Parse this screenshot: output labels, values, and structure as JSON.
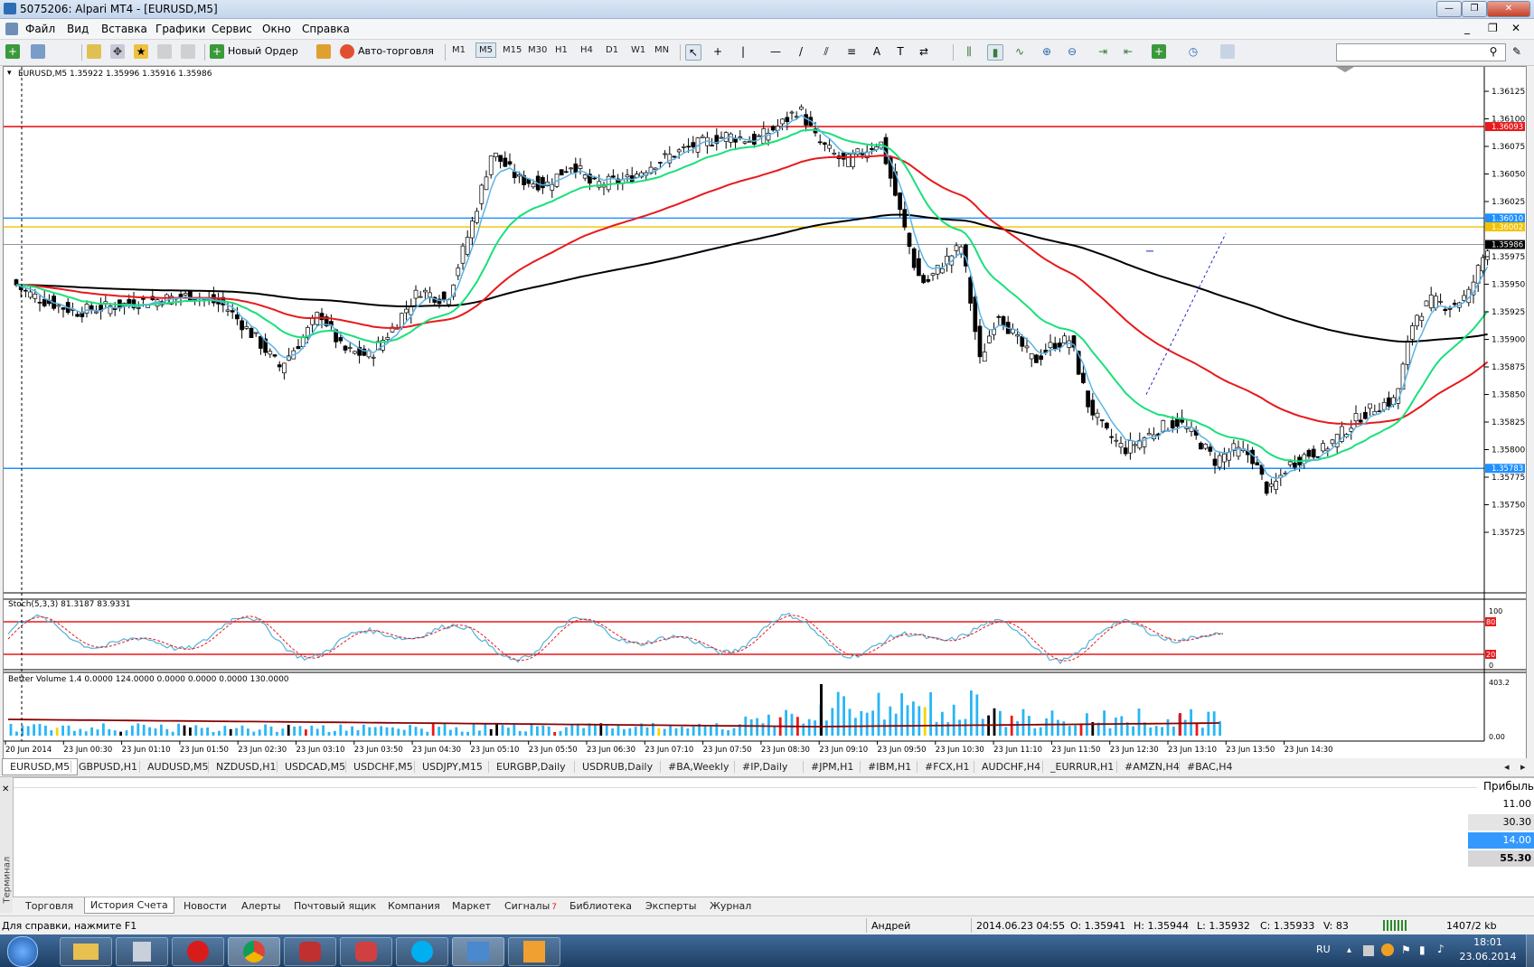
{
  "window": {
    "title": "5075206: Alpari MT4 - [EURUSD,M5]"
  },
  "menu": [
    "Файл",
    "Вид",
    "Вставка",
    "Графики",
    "Сервис",
    "Окно",
    "Справка"
  ],
  "toolbar": {
    "new_order": "Новый Ордер",
    "autotrade": "Авто-торговля",
    "timeframes": [
      "M1",
      "M5",
      "M15",
      "M30",
      "H1",
      "H4",
      "D1",
      "W1",
      "MN"
    ],
    "text_tool": "A",
    "active_timeframe": "M5"
  },
  "chart": {
    "header": "EURUSD,M5  1.35922 1.35996 1.35916 1.35986",
    "price_labels": [
      "1.36125",
      "1.36100",
      "1.36075",
      "1.36050",
      "1.36025",
      "1.35975",
      "1.35950",
      "1.35925",
      "1.35900",
      "1.35875",
      "1.35850",
      "1.35825",
      "1.35800",
      "1.35775",
      "1.35750",
      "1.35725"
    ],
    "marker_labels": {
      "red": "1.36093",
      "blue_top": "1.36010",
      "yellow": "1.36002",
      "current": "1.35986",
      "blue_bottom": "1.35783"
    },
    "stoch_header": "Stoch(5,3,3) 81.3187 83.9331",
    "stoch_levels": [
      "100",
      "80",
      "20",
      "0"
    ],
    "volume_header": "Better Volume 1.4 0.0000 124.0000 0.0000 0.0000 0.0000 130.0000",
    "volume_levels": {
      "top": "403.2",
      "bottom": "0.00"
    },
    "time_labels": [
      "20 Jun 2014",
      "23 Jun 00:30",
      "23 Jun 01:10",
      "23 Jun 01:50",
      "23 Jun 02:30",
      "23 Jun 03:10",
      "23 Jun 03:50",
      "23 Jun 04:30",
      "23 Jun 05:10",
      "23 Jun 05:50",
      "23 Jun 06:30",
      "23 Jun 07:10",
      "23 Jun 07:50",
      "23 Jun 08:30",
      "23 Jun 09:10",
      "23 Jun 09:50",
      "23 Jun 10:30",
      "23 Jun 11:10",
      "23 Jun 11:50",
      "23 Jun 12:30",
      "23 Jun 13:10",
      "23 Jun 13:50",
      "23 Jun 14:30"
    ],
    "colors": {
      "bull": "#ffffff",
      "bear": "#000000",
      "ma_fast": "#5ab4e6",
      "ma_green": "#19e07a",
      "ma_red": "#e8191b",
      "ma_black": "#000000",
      "stoch_main": "#4fb3d9",
      "stoch_signal": "#e8191b"
    }
  },
  "symbol_tabs": [
    "EURUSD,M5",
    "GBPUSD,H1",
    "AUDUSD,M5",
    "NZDUSD,H1",
    "USDCAD,M5",
    "USDCHF,M5",
    "USDJPY,M15",
    "EURGBP,Daily",
    "USDRUB,Daily",
    "#BA,Weekly",
    "#IP,Daily",
    "#JPM,H1",
    "#IBM,H1",
    "#FCX,H1",
    "AUDCHF,H4",
    "_EURRUR,H1",
    "#AMZN,H4",
    "#BAC,H4"
  ],
  "terminal": {
    "side_label": "Терминал",
    "profit_header": "Прибыль",
    "profits": [
      "11.00",
      "30.30",
      "14.00",
      "55.30"
    ],
    "tabs": [
      "Торговля",
      "История Счета",
      "Новости",
      "Алерты",
      "Почтовый ящик",
      "Компания",
      "Маркет",
      "Сигналы",
      "Библиотека",
      "Эксперты",
      "Журнал"
    ],
    "signals_badge": "7"
  },
  "status": {
    "help": "Для справки, нажмите F1",
    "user": "Андрей",
    "datetime": "2014.06.23 04:55",
    "open": "O: 1.35941",
    "high": "H: 1.35944",
    "low": "L: 1.35932",
    "close": "C: 1.35933",
    "volume": "V: 83",
    "traffic": "1407/2 kb"
  },
  "taskbar": {
    "lang": "RU",
    "time": "18:01",
    "date": "23.06.2014"
  }
}
